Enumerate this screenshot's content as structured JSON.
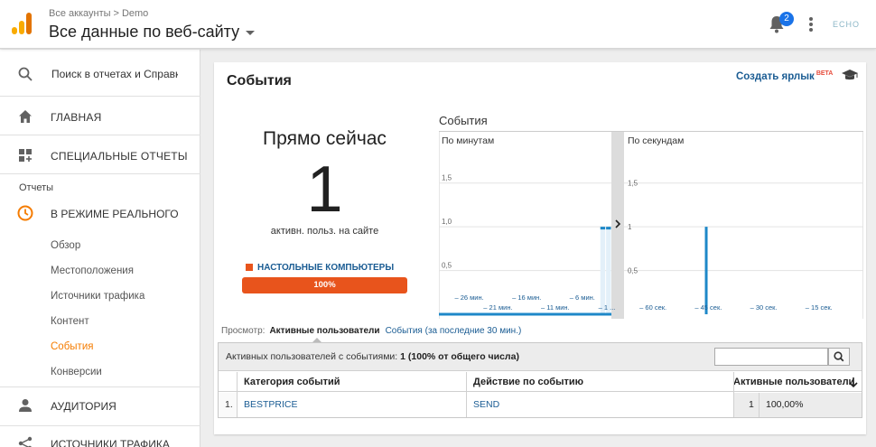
{
  "header": {
    "breadcrumb_root": "Все аккаунты",
    "breadcrumb_sep": ">",
    "breadcrumb_account": "Demo",
    "view_title": "Все данные по веб-сайту",
    "notification_count": "2",
    "account_logo": "ECHO"
  },
  "sidebar": {
    "search_placeholder": "Поиск в отчетах и Справк",
    "home": "ГЛАВНАЯ",
    "custom_reports": "СПЕЦИАЛЬНЫЕ ОТЧЕТЫ",
    "reports_section": "Отчеты",
    "realtime": "В РЕЖИМЕ РЕАЛЬНОГО",
    "realtime_items": [
      "Обзор",
      "Местоположения",
      "Источники трафика",
      "Контент",
      "События",
      "Конверсии"
    ],
    "active_item": "События",
    "audience": "АУДИТОРИЯ",
    "acquisition": "ИСТОЧНИКИ ТРАФИКА"
  },
  "card": {
    "title": "События",
    "shortcut": "Создать ярлык",
    "shortcut_badge": "BETA"
  },
  "realtime": {
    "label": "Прямо сейчас",
    "count": "1",
    "sub": "активн. польз. на сайте",
    "device_label": "НАСТОЛЬНЫЕ КОМПЬЮТЕРЫ",
    "device_percent": "100%",
    "device_color": "#e8541c"
  },
  "chart_data": [
    {
      "type": "bar",
      "title": "События",
      "subtitle": "По минутам",
      "ylim": [
        0,
        1.6
      ],
      "y_ticks": [
        "1,5",
        "1,0",
        "0,5"
      ],
      "x_ticks_top": [
        "– 26 мин.",
        "– 16 мин.",
        "– 6 мин."
      ],
      "x_ticks_bottom": [
        "– 21 мин.",
        "– 11 мин.",
        "– 1 ..."
      ],
      "x": [
        -1,
        -2
      ],
      "values": [
        1,
        1
      ],
      "color": "#1e88c8"
    },
    {
      "type": "bar",
      "subtitle": "По секундам",
      "ylim": [
        0,
        1.6
      ],
      "y_ticks": [
        "1,5",
        "1",
        "0,5"
      ],
      "x_ticks": [
        "– 60 сек.",
        "– 45 сек.",
        "– 30 сек.",
        "– 15 сек."
      ],
      "x": [
        -43
      ],
      "values": [
        1
      ],
      "color": "#1e88c8"
    }
  ],
  "view": {
    "label": "Просмотр:",
    "active_tab": "Активные пользователи",
    "other_tab": "События (за последние 30 мин.)"
  },
  "table": {
    "summary_label": "Активных пользователей с событиями:",
    "summary_value": "1 (100% от общего числа)",
    "columns": [
      "Категория событий",
      "Действие по событию",
      "Активные пользователи"
    ],
    "rows": [
      {
        "index": "1.",
        "category": "BESTPRICE",
        "action": "SEND",
        "users": "1",
        "percent": "100,00%"
      }
    ]
  }
}
